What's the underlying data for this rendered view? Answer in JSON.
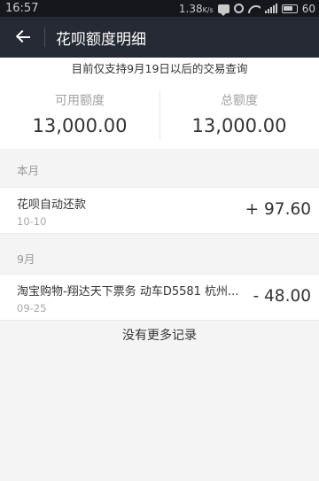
{
  "status_bar": {
    "time": "16:57",
    "data_speed": "1.38",
    "data_speed_unit": "K/s",
    "battery_level": "60",
    "icons": [
      "message-icon",
      "clock-icon",
      "wifi-icon",
      "signal-icon",
      "battery-icon"
    ]
  },
  "header": {
    "back_icon": "arrow-left-icon",
    "title": "花呗额度明细"
  },
  "notice": "目前仅支持9月19日以后的交易查询",
  "quota": {
    "available_label": "可用额度",
    "available_value": "13,000.00",
    "total_label": "总额度",
    "total_value": "13,000.00"
  },
  "sections": [
    {
      "month": "本月",
      "records": [
        {
          "title": "花呗自动还款",
          "date": "10-10",
          "amount": "+ 97.60"
        }
      ]
    },
    {
      "month": "9月",
      "records": [
        {
          "title": "淘宝购物-翔达天下票务 动车D5581 杭州...",
          "date": "09-25",
          "amount": "- 48.00"
        }
      ]
    }
  ],
  "footer_text": "没有更多记录",
  "colors": {
    "header_bg": "#252a34",
    "status_bar_bg": "#15171c",
    "page_bg": "#f4f4f4",
    "text_primary": "#333333",
    "text_secondary": "#a2a2a2"
  }
}
